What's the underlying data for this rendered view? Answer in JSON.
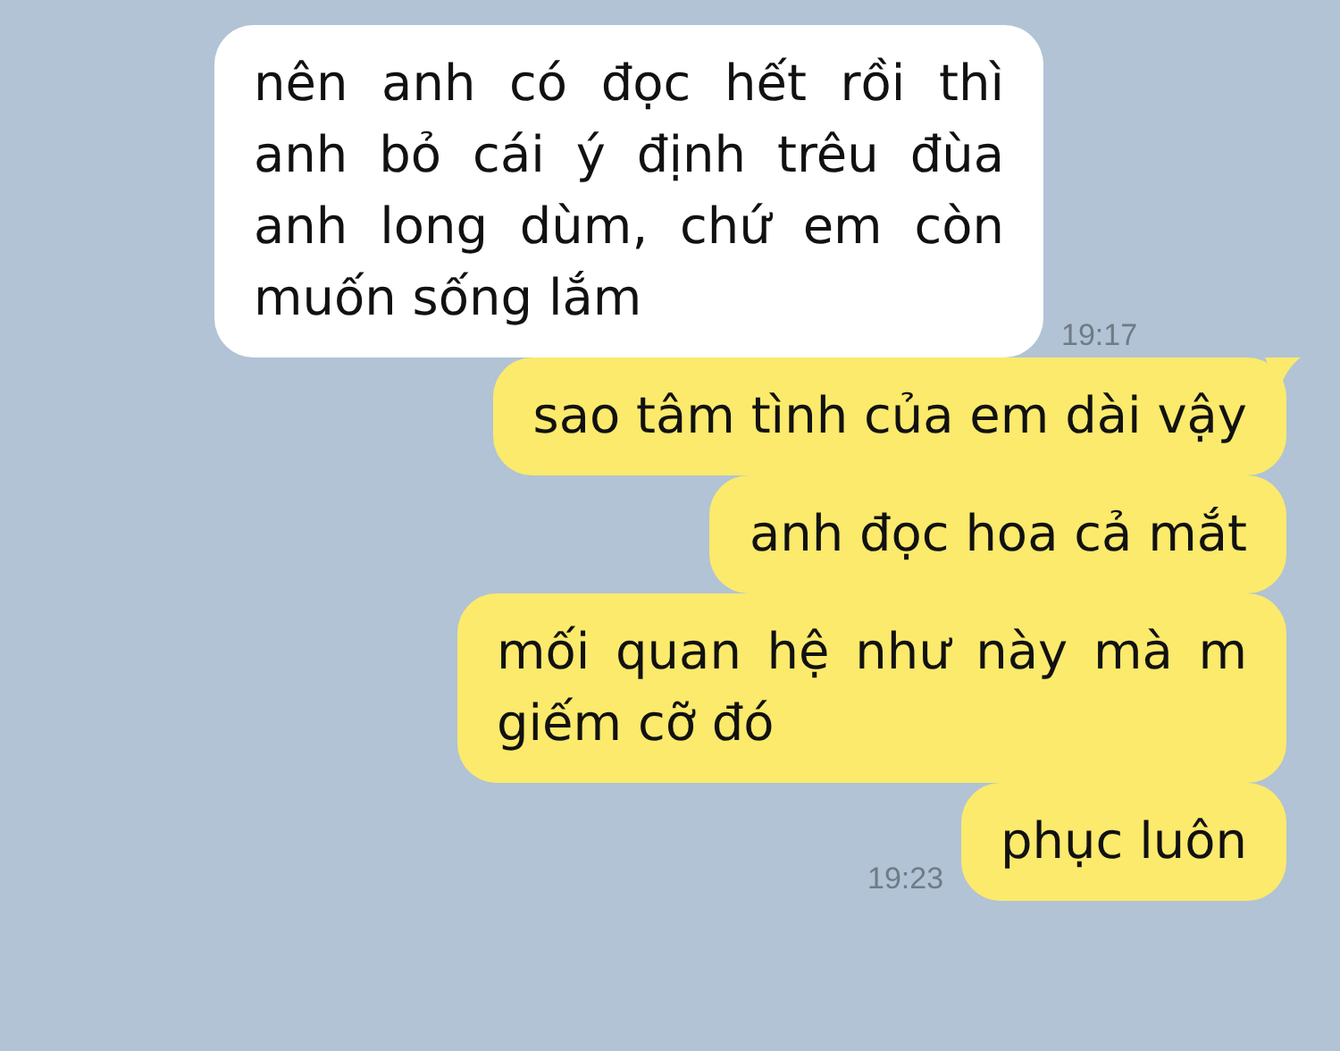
{
  "messages": [
    {
      "kind": "received",
      "text": "nên anh có đọc hết rồi thì anh bỏ cái ý định trêu đùa anh long dùm, chứ em còn muốn sống lắm",
      "time": "19:17"
    },
    {
      "kind": "sent",
      "text": "sao tâm tình của em dài vậy",
      "tail": true
    },
    {
      "kind": "sent",
      "text": "anh đọc hoa cả mắt"
    },
    {
      "kind": "sent",
      "text": "mối quan hệ như này mà m giếm cỡ đó"
    },
    {
      "kind": "sent",
      "text": "phục luôn",
      "time": "19:23"
    }
  ]
}
